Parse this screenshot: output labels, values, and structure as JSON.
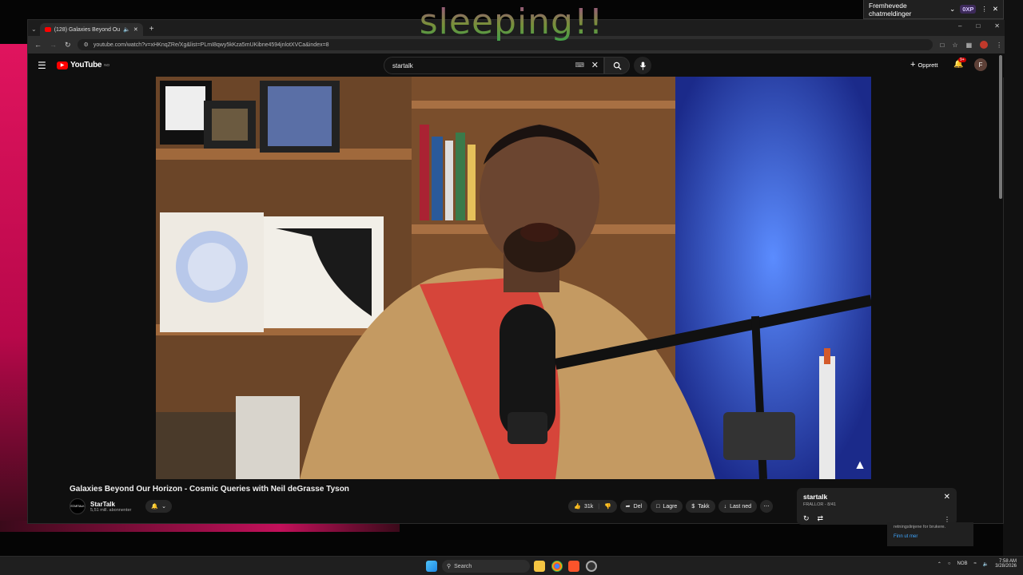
{
  "overlay_text": "sleeping!!",
  "chat_popup": {
    "label": "Fremhevede chatmeldinger",
    "xp_badge": "0XP"
  },
  "browser": {
    "tab_title": "(128) Galaxies Beyond Ou",
    "url": "youtube.com/watch?v=xHKnqZRe/Xg&list=PLmI8qwy5kKza5mUKibne4594jnlotXVCa&index=8"
  },
  "youtube": {
    "logo_text": "YouTube",
    "logo_region": "NO",
    "search_value": "startalk",
    "create_label": "Opprett",
    "notif_count": "9+",
    "avatar_letter": "F"
  },
  "video": {
    "title": "Galaxies Beyond Our Horizon - Cosmic Queries with Neil deGrasse Tyson",
    "channel_name": "StarTalk",
    "channel_logo_text": "STARTALK",
    "subscribers": "5,51 mill. abonnenter",
    "likes": "31k",
    "share_label": "Del",
    "save_label": "Lagre",
    "thanks_label": "Takk",
    "download_label": "Last ned"
  },
  "playlist": {
    "title": "startalk",
    "subtitle": "FRALLOR - 8/41"
  },
  "taskbar": {
    "search_label": "Search",
    "time": "7:58 AM",
    "date": "3/28/2026",
    "lang": "NOB"
  },
  "notification": {
    "text": "retningslinjene for brukere.",
    "link": "Finn ut mer"
  },
  "colors": {
    "yt_red": "#ff0000",
    "accent_blue": "#3ea6ff",
    "pink": "#e0145e"
  }
}
